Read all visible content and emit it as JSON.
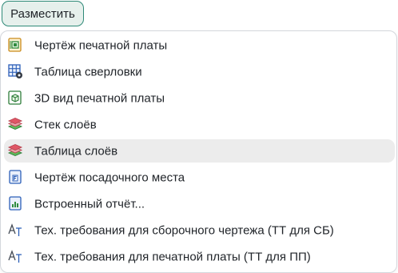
{
  "place_button": {
    "label": "Разместить"
  },
  "menu": {
    "hovered_index": 4,
    "items": [
      {
        "label": "Чертёж печатной платы",
        "icon": "pcb-drawing-icon"
      },
      {
        "label": "Таблица сверловки",
        "icon": "drill-table-icon"
      },
      {
        "label": "3D вид печатной платы",
        "icon": "pcb-3d-view-icon"
      },
      {
        "label": "Стек слоёв",
        "icon": "layer-stack-icon"
      },
      {
        "label": "Таблица слоёв",
        "icon": "layer-table-icon"
      },
      {
        "label": "Чертёж посадочного места",
        "icon": "footprint-drawing-icon"
      },
      {
        "label": "Встроенный отчёт...",
        "icon": "embedded-report-icon"
      },
      {
        "label": "Тех. требования для сборочного чертежа (ТТ для СБ)",
        "icon": "text-requirements-icon"
      },
      {
        "label": "Тех. требования для печатной платы (ТТ для ПП)",
        "icon": "text-requirements-icon"
      }
    ]
  }
}
